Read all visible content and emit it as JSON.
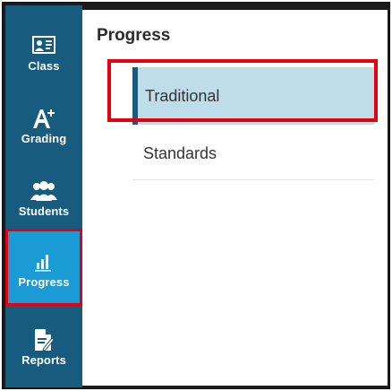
{
  "sidebar": {
    "items": [
      {
        "label": "Class",
        "icon": "class-icon"
      },
      {
        "label": "Grading",
        "icon": "grading-icon"
      },
      {
        "label": "Students",
        "icon": "students-icon"
      },
      {
        "label": "Progress",
        "icon": "progress-icon",
        "active": true
      },
      {
        "label": "Reports",
        "icon": "reports-icon"
      }
    ]
  },
  "panel": {
    "title": "Progress",
    "options": [
      {
        "label": "Traditional",
        "selected": true
      },
      {
        "label": "Standards",
        "selected": false
      }
    ]
  },
  "colors": {
    "sidebar_bg": "#175b7f",
    "active_bg": "#1a9bd5",
    "highlight_border": "#e6000f",
    "selected_option_bg": "#bfdde8"
  }
}
